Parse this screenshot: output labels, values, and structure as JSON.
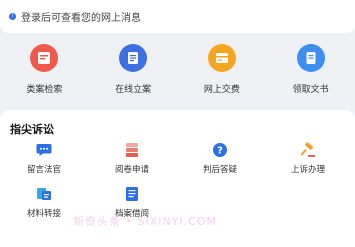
{
  "notice": {
    "text": "登录后可查看您的网上消息",
    "icon": "info-icon"
  },
  "quick_actions": [
    {
      "label": "类案检索",
      "icon": "case-search-icon",
      "color": "#ef5a4c"
    },
    {
      "label": "在线立案",
      "icon": "online-filing-icon",
      "color": "#3d6fe0"
    },
    {
      "label": "网上交费",
      "icon": "online-payment-icon",
      "color": "#f4a623"
    },
    {
      "label": "领取文书",
      "icon": "document-collect-icon",
      "color": "#3d8ef0"
    }
  ],
  "fingertip": {
    "title": "指尖诉讼",
    "items": [
      {
        "label": "留言法官",
        "icon": "chat-icon",
        "color": "#2f6fe4"
      },
      {
        "label": "阅卷申请",
        "icon": "file-stack-icon",
        "color": "#ee7b6d"
      },
      {
        "label": "判后答疑",
        "icon": "question-icon",
        "color": "#2f6fe4"
      },
      {
        "label": "上诉办理",
        "icon": "gavel-icon",
        "color": "#f2a02b"
      },
      {
        "label": "材料转接",
        "icon": "transfer-icon",
        "color": "#35a8e0"
      },
      {
        "label": "档案借阅",
        "icon": "archive-icon",
        "color": "#2f6fe4"
      }
    ]
  },
  "watermark": "新奇头条 • SIXINYI.COM"
}
